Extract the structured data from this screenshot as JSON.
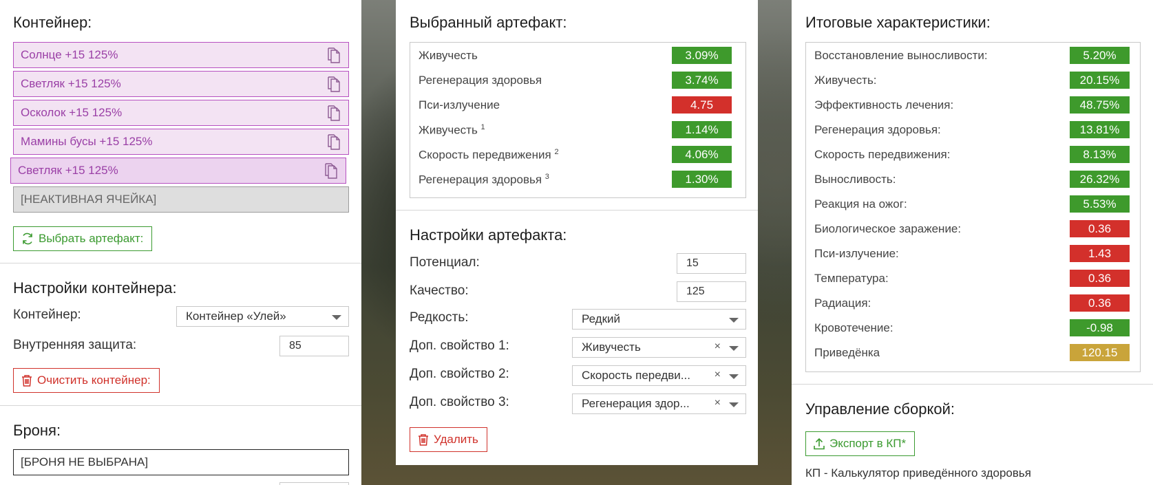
{
  "colors": {
    "green": "#3e9a2c",
    "red": "#d3302b",
    "gold": "#c9a43a",
    "purple": "#b64fc0"
  },
  "container": {
    "title": "Контейнер:",
    "slots": [
      "Солнце +15 125%",
      "Светляк +15 125%",
      "Осколок +15 125%",
      "Мамины бусы +15 125%",
      "Светляк +15 125%"
    ],
    "inactive_slot": "[НЕАКТИВНАЯ ЯЧЕЙКА]",
    "select_button": "Выбрать артефакт:"
  },
  "container_settings": {
    "title": "Настройки контейнера:",
    "container_label": "Контейнер:",
    "container_value": "Контейнер «Улей»",
    "protection_label": "Внутренняя защита:",
    "protection_value": "85",
    "clear_button": "Очистить контейнер:"
  },
  "armor": {
    "title": "Броня:",
    "value": "[БРОНЯ НЕ ВЫБРАНА]"
  },
  "selected_artifact": {
    "title": "Выбранный артефакт:",
    "stats": [
      {
        "name": "Живучесть",
        "sup": "",
        "value": "3.09%",
        "kind": "green"
      },
      {
        "name": "Регенерация здоровья",
        "sup": "",
        "value": "3.74%",
        "kind": "green"
      },
      {
        "name": "Пси-излучение",
        "sup": "",
        "value": "4.75",
        "kind": "red"
      },
      {
        "name": "Живучесть",
        "sup": "1",
        "value": "1.14%",
        "kind": "green"
      },
      {
        "name": "Скорость передвижения",
        "sup": "2",
        "value": "4.06%",
        "kind": "green"
      },
      {
        "name": "Регенерация здоровья",
        "sup": "3",
        "value": "1.30%",
        "kind": "green"
      }
    ]
  },
  "artifact_settings": {
    "title": "Настройки артефакта:",
    "potential_label": "Потенциал:",
    "potential_value": "15",
    "quality_label": "Качество:",
    "quality_value": "125",
    "rarity_label": "Редкость:",
    "rarity_value": "Редкий",
    "prop1_label": "Доп. свойство 1:",
    "prop1_value": "Живучесть",
    "prop2_label": "Доп. свойство 2:",
    "prop2_value": "Скорость передви...",
    "prop3_label": "Доп. свойство 3:",
    "prop3_value": "Регенерация здор...",
    "clear_glyph": "×",
    "delete_button": "Удалить"
  },
  "totals": {
    "title": "Итоговые характеристики:",
    "stats": [
      {
        "name": "Восстановление выносливости:",
        "value": "5.20%",
        "kind": "green"
      },
      {
        "name": "Живучесть:",
        "value": "20.15%",
        "kind": "green"
      },
      {
        "name": "Эффективность лечения:",
        "value": "48.75%",
        "kind": "green"
      },
      {
        "name": "Регенерация здоровья:",
        "value": "13.81%",
        "kind": "green"
      },
      {
        "name": "Скорость передвижения:",
        "value": "8.13%",
        "kind": "green"
      },
      {
        "name": "Выносливость:",
        "value": "26.32%",
        "kind": "green"
      },
      {
        "name": "Реакция на ожог:",
        "value": "5.53%",
        "kind": "green"
      },
      {
        "name": "Биологическое заражение:",
        "value": "0.36",
        "kind": "red"
      },
      {
        "name": "Пси-излучение:",
        "value": "1.43",
        "kind": "red"
      },
      {
        "name": "Температура:",
        "value": "0.36",
        "kind": "red"
      },
      {
        "name": "Радиация:",
        "value": "0.36",
        "kind": "red"
      },
      {
        "name": "Кровотечение:",
        "value": "-0.98",
        "kind": "green"
      },
      {
        "name": "Приведёнка",
        "value": "120.15",
        "kind": "gold"
      }
    ]
  },
  "build": {
    "title": "Управление сборкой:",
    "export_button": "Экспорт в КП*",
    "note": "КП - Калькулятор приведённого здоровья"
  }
}
